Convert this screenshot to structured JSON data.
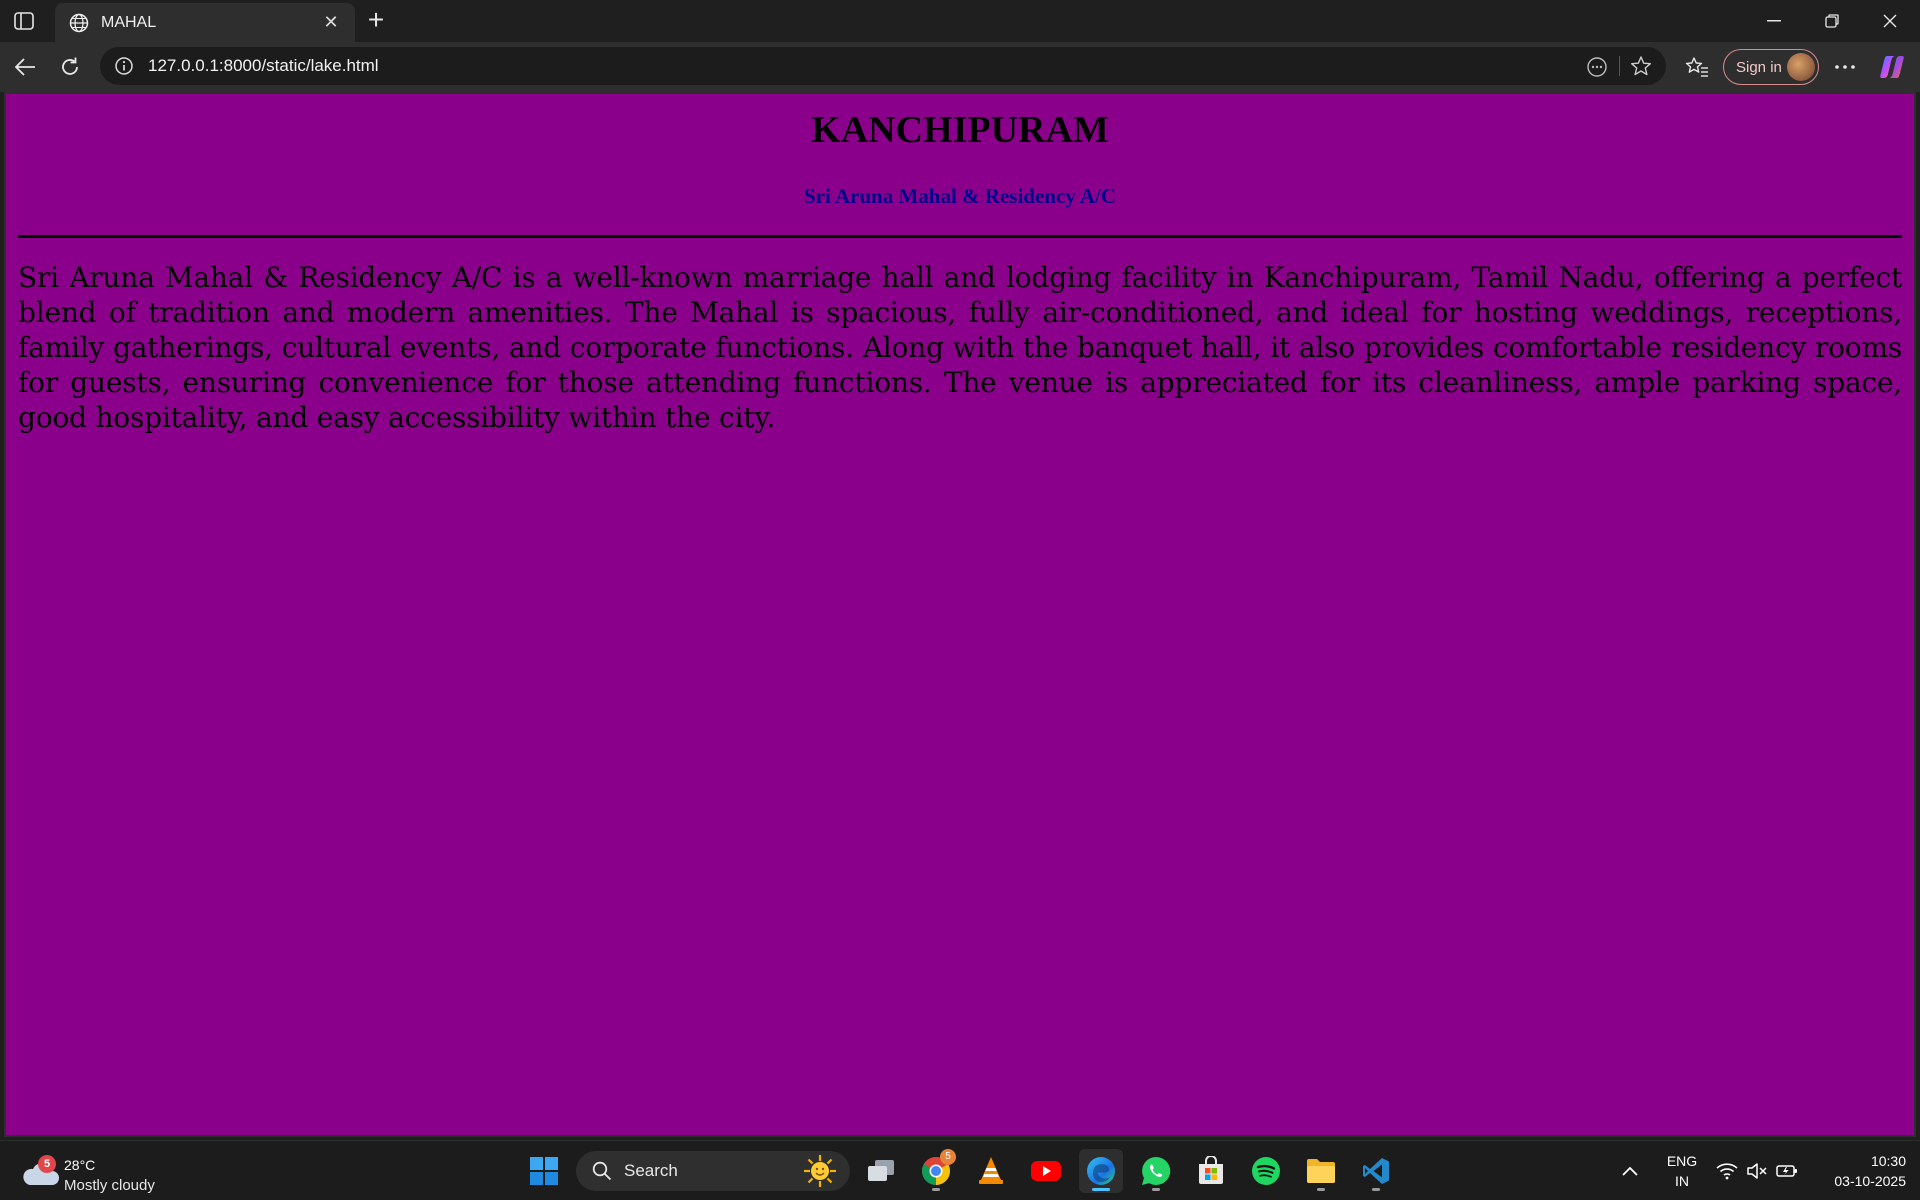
{
  "browser": {
    "tab_title": "MAHAL",
    "url": "127.0.0.1:8000/static/lake.html",
    "signin_label": "Sign in"
  },
  "page": {
    "heading": "KANCHIPURAM",
    "subheading": "Sri Aruna Mahal & Residency A/C",
    "paragraph": "Sri Aruna Mahal & Residency A/C is a well-known marriage hall and lodging facility in Kanchipuram, Tamil Nadu, offering a perfect blend of tradition and modern amenities. The Mahal is spacious, fully air-conditioned, and ideal for hosting weddings, receptions, family gatherings, cultural events, and corporate functions. Along with the banquet hall, it also provides comfortable residency rooms for guests, ensuring convenience for those attending functions. The venue is appreciated for its cleanliness, ample parking space, good hospitality, and easy accessibility within the city.",
    "background_color": "#8b008b",
    "subheading_color": "#00008b"
  },
  "taskbar": {
    "weather_temp": "28°C",
    "weather_condition": "Mostly cloudy",
    "weather_badge": "5",
    "search_label": "Search",
    "chrome_badge": "5",
    "lang_line1": "ENG",
    "lang_line2": "IN",
    "time": "10:30",
    "date": "03-10-2025",
    "apps": [
      "task-view",
      "chrome",
      "vlc",
      "youtube",
      "edge",
      "whatsapp",
      "microsoft-store",
      "spotify",
      "file-explorer",
      "vscode"
    ]
  }
}
